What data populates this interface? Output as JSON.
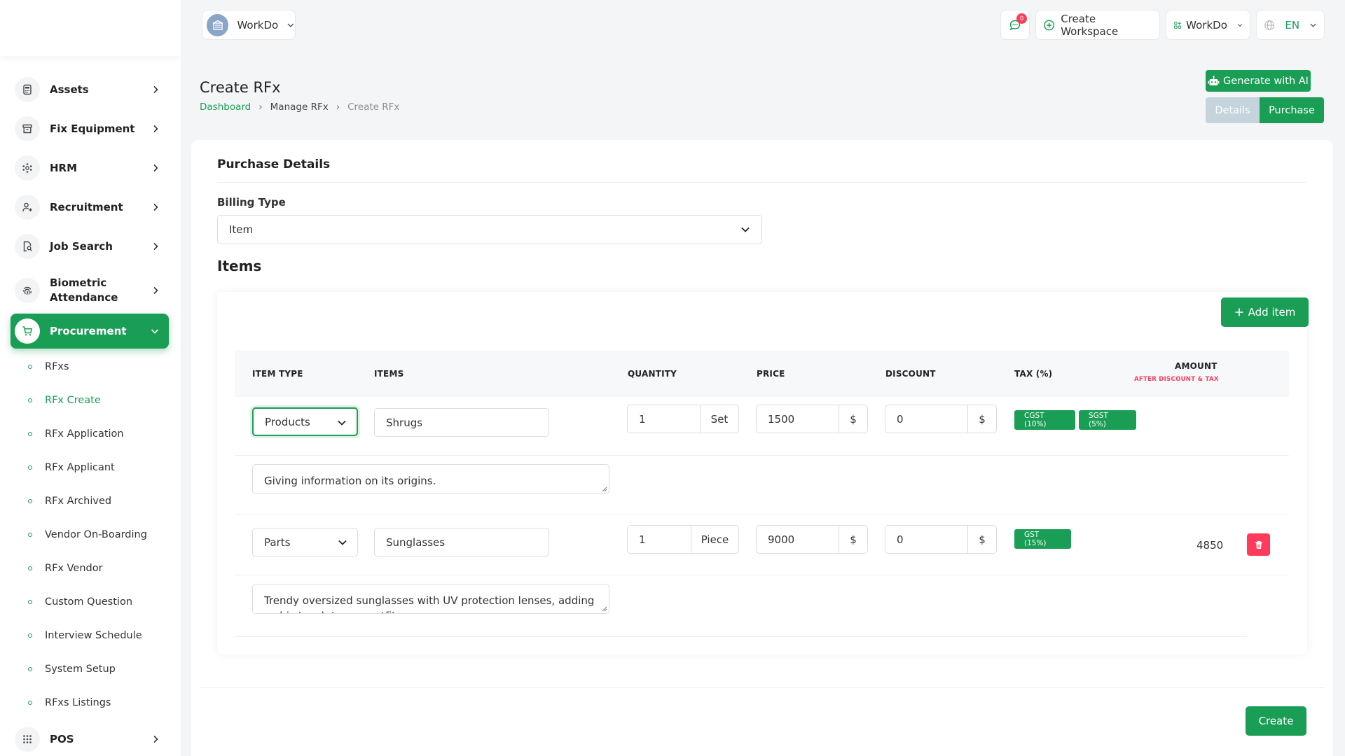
{
  "sidebar": {
    "items": [
      {
        "label": "Assets",
        "icon": "calculator-icon"
      },
      {
        "label": "Fix Equipment",
        "icon": "archive-icon"
      },
      {
        "label": "HRM",
        "icon": "hrm-icon"
      },
      {
        "label": "Recruitment",
        "icon": "user-plus-icon"
      },
      {
        "label": "Job Search",
        "icon": "file-search-icon"
      },
      {
        "label": "Biometric Attendance",
        "icon": "fingerprint-icon"
      },
      {
        "label": "Procurement",
        "icon": "cart-icon"
      },
      {
        "label": "POS",
        "icon": "grid-icon"
      }
    ],
    "subitems": [
      "RFxs",
      "RFx Create",
      "RFx Application",
      "RFx Applicant",
      "RFx Archived",
      "Vendor On-Boarding",
      "RFx Vendor",
      "Custom Question",
      "Interview Schedule",
      "System Setup",
      "RFxs Listings"
    ]
  },
  "header": {
    "workspace": "WorkDo",
    "notification_count": "0",
    "create_workspace": "Create Workspace",
    "workspace_switch": "WorkDo",
    "language": "EN"
  },
  "page": {
    "title": "Create RFx",
    "breadcrumb": [
      "Dashboard",
      "Manage RFx",
      "Create RFx"
    ],
    "generate_ai": "Generate with AI",
    "tabs": {
      "details": "Details",
      "purchase": "Purchase"
    }
  },
  "purchase": {
    "section_title": "Purchase Details",
    "billing_type_label": "Billing Type",
    "billing_type_value": "Item",
    "items_title": "Items",
    "add_item": "Add item",
    "columns": {
      "item_type": "ITEM TYPE",
      "items": "ITEMS",
      "quantity": "QUANTITY",
      "price": "PRICE",
      "discount": "DISCOUNT",
      "tax": "TAX (%)",
      "amount": "AMOUNT",
      "amount_sub": "AFTER DISCOUNT & TAX"
    },
    "rows": [
      {
        "item_type": "Products",
        "item": "Shrugs",
        "quantity": "1",
        "unit": "Set",
        "price": "1500",
        "currency": "$",
        "discount": "0",
        "discount_currency": "$",
        "taxes": [
          "CGST (10%)",
          "SGST (5%)"
        ],
        "amount": "",
        "description": "Giving information on its origins."
      },
      {
        "item_type": "Parts",
        "item": "Sunglasses",
        "quantity": "1",
        "unit": "Piece",
        "price": "9000",
        "currency": "$",
        "discount": "0",
        "discount_currency": "$",
        "taxes": [
          "GST (15%)"
        ],
        "amount": "4850",
        "description": "Trendy oversized sunglasses with UV protection lenses, adding a chic touch to any outfit."
      }
    ],
    "create": "Create"
  },
  "colors": {
    "accent": "#1a9e55",
    "danger": "#ff3b5c",
    "disabled_tab": "#c5d3dd"
  }
}
